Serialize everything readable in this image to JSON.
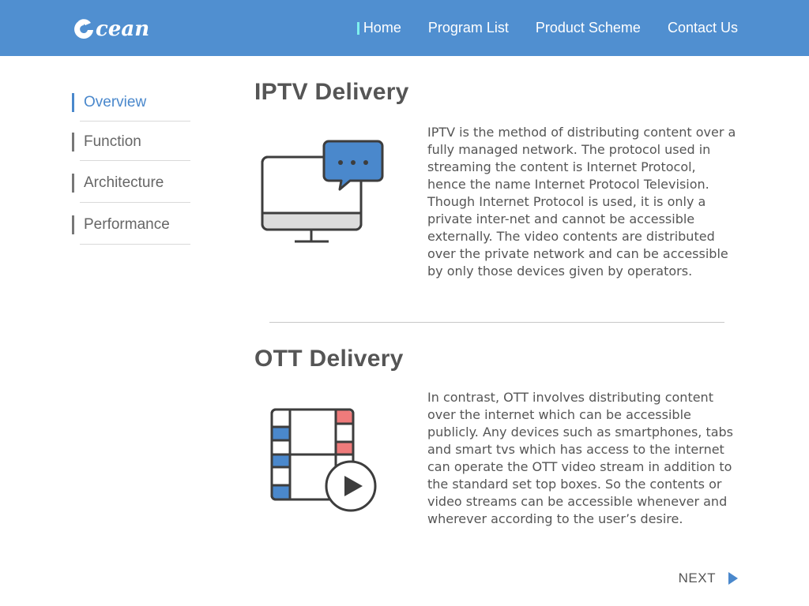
{
  "brand": {
    "logo_text": "cean"
  },
  "nav": {
    "items": [
      {
        "label": "Home",
        "active": true
      },
      {
        "label": "Program List",
        "active": false
      },
      {
        "label": "Product Scheme",
        "active": false
      },
      {
        "label": "Contact Us",
        "active": false
      }
    ]
  },
  "sidebar": {
    "items": [
      {
        "label": "Overview",
        "active": true
      },
      {
        "label": "Function",
        "active": false
      },
      {
        "label": "Architecture",
        "active": false
      },
      {
        "label": "Performance",
        "active": false
      }
    ]
  },
  "sections": [
    {
      "title": "IPTV Delivery",
      "text": "IPTV is the method of distributing content over a fully managed network. The protocol used in streaming the content is Internet Protocol, hence the name Internet Protocol Television. Though Internet Protocol is used, it is only a private inter-net and cannot be accessible externally. The video contents are distributed over the private network and can be accessible by only those devices given by operators.",
      "icon": "monitor-chat-icon"
    },
    {
      "title": "OTT Delivery",
      "text": "In contrast, OTT involves distributing content over the internet which can be accessible publicly. Any devices such as smartphones, tabs and smart tvs which has access to the internet can operate the OTT video stream in addition to the standard set top boxes. So the contents or video streams can be accessible whenever and wherever according to the user’s desire.",
      "icon": "film-play-icon"
    }
  ],
  "pager": {
    "next_label": "NEXT",
    "next_icon": "play-arrow-icon"
  },
  "colors": {
    "header_bg": "#508fd0",
    "accent": "#4a88cc",
    "active_nav_marker": "#7ff0ee",
    "film_red": "#ef7b7b",
    "text": "#555555"
  }
}
